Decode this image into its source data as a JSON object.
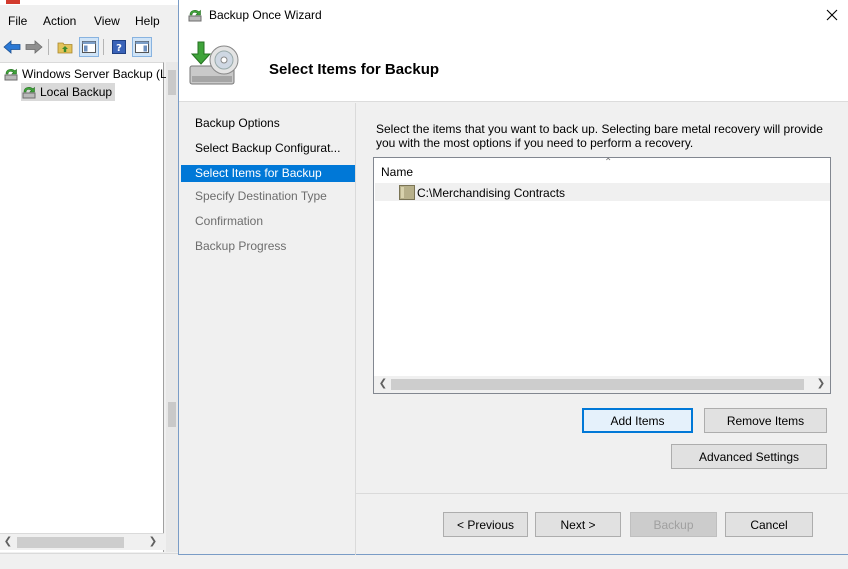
{
  "mmc": {
    "menu": [
      "File",
      "Action",
      "View",
      "Help"
    ],
    "tree": {
      "root_label": "Windows Server Backup (Local)",
      "child_label": "Local Backup"
    }
  },
  "wizard": {
    "title": "Backup Once Wizard",
    "heading": "Select Items for Backup",
    "steps": [
      {
        "label": "Backup Options",
        "state": "done"
      },
      {
        "label": "Select Backup Configurat...",
        "state": "done"
      },
      {
        "label": "Select Items for Backup",
        "state": "active"
      },
      {
        "label": "Specify Destination Type",
        "state": "pending"
      },
      {
        "label": "Confirmation",
        "state": "pending"
      },
      {
        "label": "Backup Progress",
        "state": "pending"
      }
    ],
    "description": "Select the items that you want to back up. Selecting bare metal recovery will provide you with the most options if you need to perform a recovery.",
    "list": {
      "column_name": "Name",
      "items": [
        "C:\\Merchandising Contracts"
      ]
    },
    "buttons": {
      "add_items": "Add Items",
      "remove_items": "Remove Items",
      "advanced_settings": "Advanced Settings",
      "previous": "< Previous",
      "next": "Next >",
      "backup": "Backup",
      "cancel": "Cancel"
    }
  },
  "colors": {
    "accent": "#0078d7",
    "window_bg": "#f0f0f0"
  }
}
